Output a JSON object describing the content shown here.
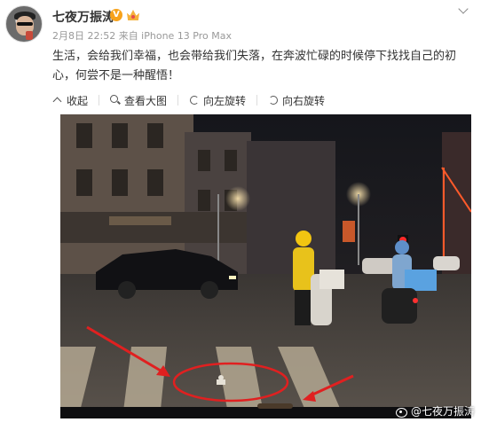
{
  "post": {
    "username": "七夜万振涛",
    "verified_badge": "V",
    "meta": "2月8日 22:52 来自 iPhone 13 Pro Max",
    "content": "生活，会给我们幸福，也会带给我们失落，在奔波忙碌的时候停下找找自己的初心，何尝不是一种醒悟！",
    "icons": {
      "avatar": "user-avatar",
      "level": "crown-badge-icon",
      "menu": "chevron-down-icon"
    }
  },
  "toolbar": {
    "collapse": "收起",
    "view_large": "查看大图",
    "rotate_left": "向左旋转",
    "rotate_right": "向右旋转"
  },
  "image": {
    "watermark": "@七夜万振涛",
    "annotation_color": "#e02020"
  }
}
